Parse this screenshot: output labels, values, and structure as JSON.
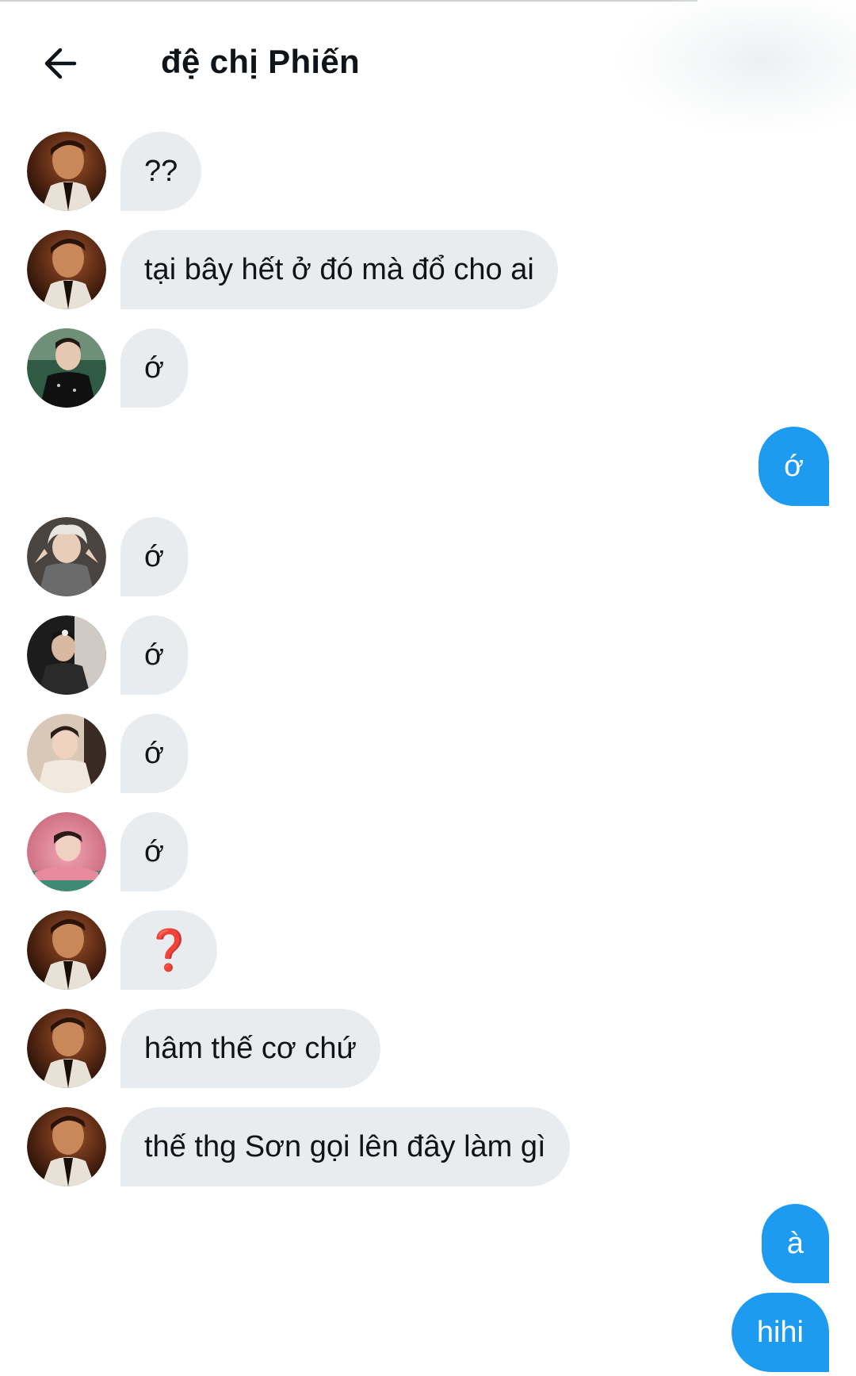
{
  "header": {
    "title": "đệ chị Phiến",
    "back_icon": "arrow-left-icon"
  },
  "colors": {
    "incoming_bubble": "#e9ecef",
    "outgoing_bubble": "#1d9bf0",
    "text": "#0f1419",
    "red_mark": "#d0211c"
  },
  "messages": [
    {
      "direction": "incoming",
      "avatar": "avatar-dark-portrait",
      "text": "??"
    },
    {
      "direction": "incoming",
      "avatar": "avatar-dark-portrait",
      "text": "tại bây hết ở đó mà đổ cho ai"
    },
    {
      "direction": "incoming",
      "avatar": "avatar-black-jacket",
      "text": "ớ"
    },
    {
      "direction": "outgoing",
      "text": "ớ"
    },
    {
      "direction": "incoming",
      "avatar": "avatar-silver-hair",
      "text": "ớ"
    },
    {
      "direction": "incoming",
      "avatar": "avatar-dark-suit",
      "text": "ớ"
    },
    {
      "direction": "incoming",
      "avatar": "avatar-cream-sweater",
      "text": "ớ"
    },
    {
      "direction": "incoming",
      "avatar": "avatar-pink-outfit",
      "text": "ớ"
    },
    {
      "direction": "incoming",
      "avatar": "avatar-dark-portrait",
      "text": "❓"
    },
    {
      "direction": "incoming",
      "avatar": "avatar-dark-portrait",
      "text": "hâm thế cơ chứ"
    },
    {
      "direction": "incoming",
      "avatar": "avatar-dark-portrait",
      "text": "thế thg Sơn gọi lên đây làm gì"
    },
    {
      "direction": "outgoing",
      "text": "à"
    },
    {
      "direction": "outgoing",
      "text": "hihi"
    }
  ]
}
